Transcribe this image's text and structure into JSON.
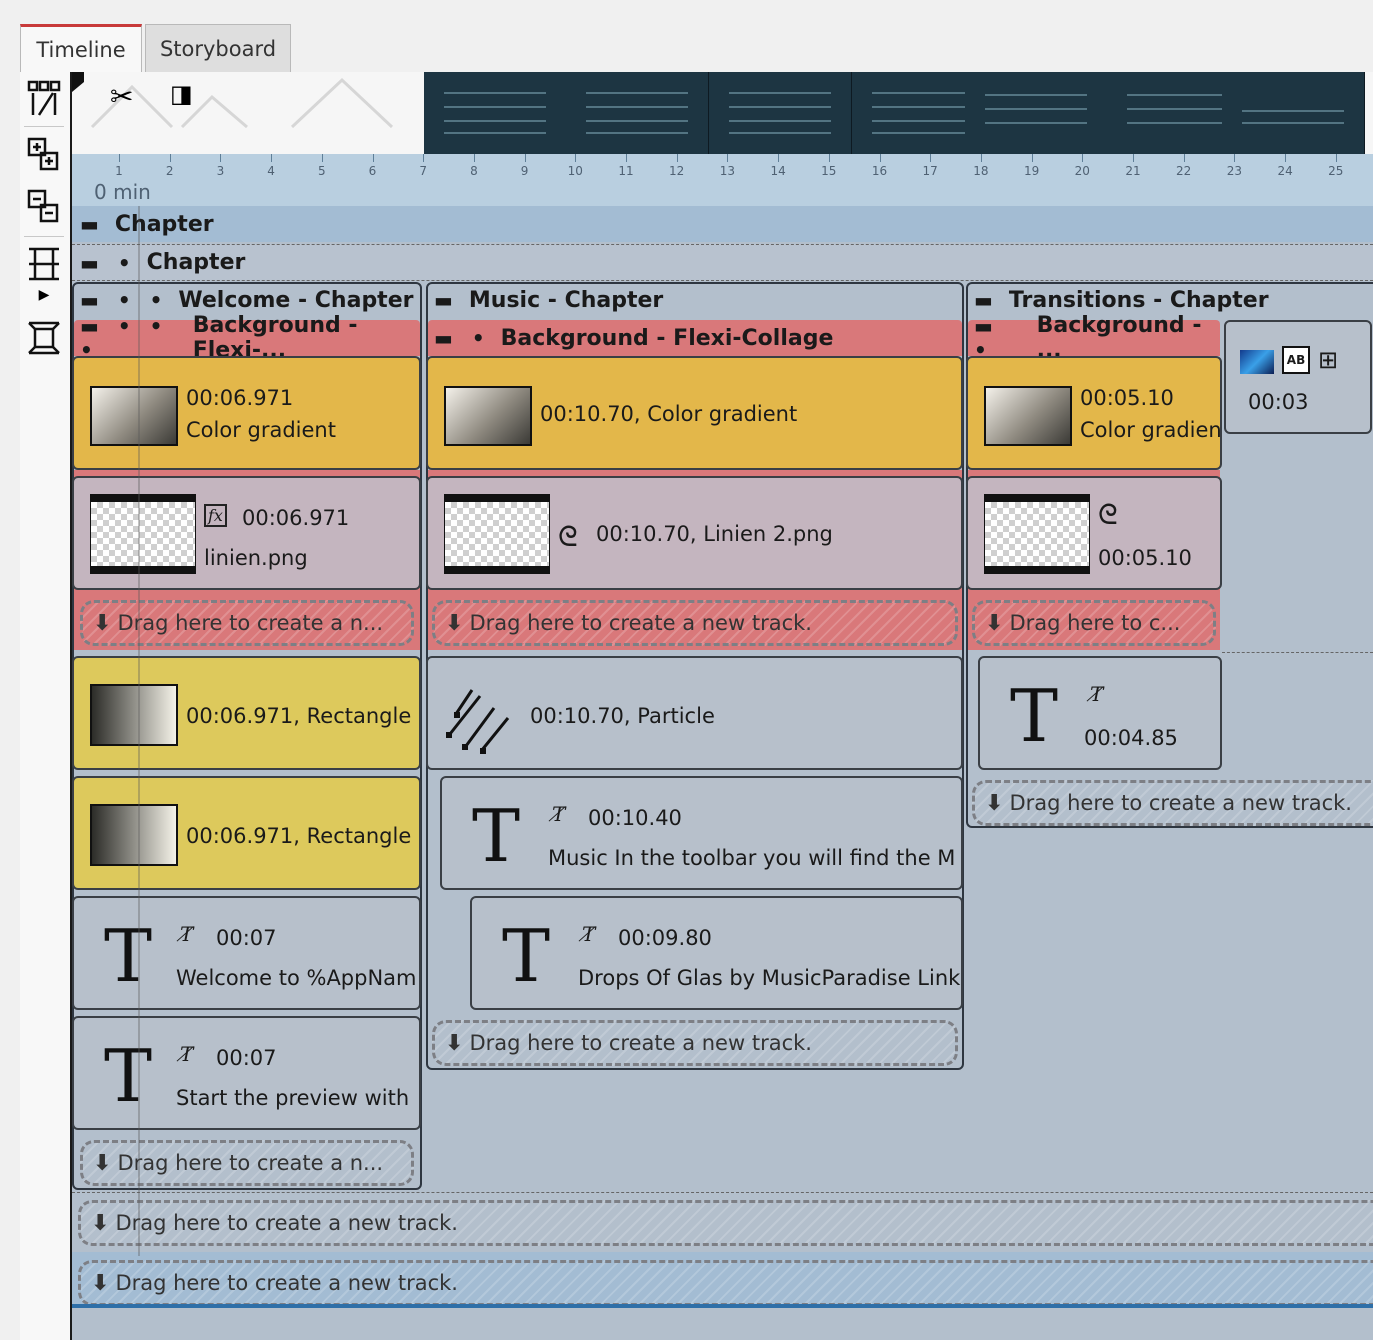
{
  "tabs": [
    {
      "label": "Timeline",
      "active": true
    },
    {
      "label": "Storyboard",
      "active": false
    }
  ],
  "ruler": {
    "unit_label": "0 min",
    "ticks": [
      "1",
      "2",
      "3",
      "4",
      "5",
      "6",
      "7",
      "8",
      "9",
      "10",
      "11",
      "12",
      "13",
      "14",
      "15",
      "16",
      "17",
      "18",
      "19",
      "20",
      "21",
      "22",
      "23",
      "24",
      "25"
    ]
  },
  "chapters": {
    "root": "Chapter",
    "sub": "Chapter",
    "welcome": "Welcome - Chapter",
    "music": "Music - Chapter",
    "transitions": "Transitions - Chapter"
  },
  "welcome": {
    "background": "Background - Flexi-...",
    "gradient_time": "00:06.971",
    "gradient_name": "Color gradient",
    "linien_time": "00:06.971",
    "linien_name": "linien.png",
    "drop1": "Drag here to create a n...",
    "rect1": "00:06.971, Rectangle",
    "rect2": "00:06.971, Rectangle",
    "text1_time": "00:07",
    "text1_name": "Welcome to %AppNam",
    "text2_time": "00:07",
    "text2_name": "Start the preview with",
    "drop2": "Drag here to create a n..."
  },
  "music": {
    "background": "Background - Flexi-Collage",
    "gradient": "00:10.70, Color gradient",
    "linien": "00:10.70, Linien 2.png",
    "drop1": "Drag here to create a new track.",
    "particle": "00:10.70, Particle",
    "text1_time": "00:10.40",
    "text1_name": "Music In the toolbar you will find the M",
    "text2_time": "00:09.80",
    "text2_name": "Drops Of Glas by MusicParadise Link",
    "drop2": "Drag here to create a new track."
  },
  "transitions": {
    "background": "Background - ...",
    "gradient_time": "00:05.10",
    "gradient_name": "Color gradient",
    "linien_time": "00:05.10",
    "drop1": "Drag here to c...",
    "transition_time": "00:03",
    "text_time": "00:04.85",
    "drop2": "Drag here to create a new track."
  },
  "bottom": {
    "drop1": "Drag here to create a new track.",
    "drop2": "Drag here to create a new track."
  },
  "colors": {
    "background_bar": "#d9787a",
    "gradient_clip": "#e3b74a",
    "rect_clip": "#ddc95c",
    "image_clip": "#c4b5bf",
    "text_clip": "#b7c0cb",
    "timeline_bg": "#b3bfcc",
    "ruler_bg": "#b9cfe0",
    "accent_blue": "#2e6fa8"
  }
}
